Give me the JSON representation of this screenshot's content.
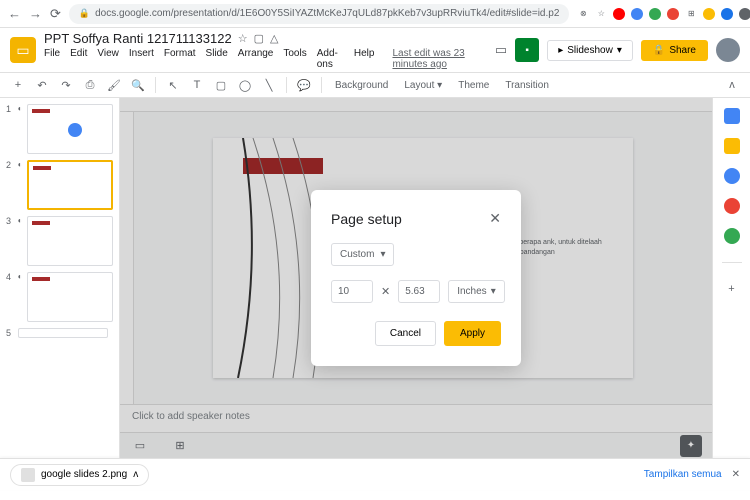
{
  "browser": {
    "url": "docs.google.com/presentation/d/1E6O0Y5SiIYAZtMcKeJ7qULd87pkKeb7v3upRRviuTk4/edit#slide=id.p2"
  },
  "header": {
    "doc_title": "PPT Soffya Ranti 121711133122",
    "menus": [
      "File",
      "Edit",
      "View",
      "Insert",
      "Format",
      "Slide",
      "Arrange",
      "Tools",
      "Add-ons",
      "Help"
    ],
    "last_edit": "Last edit was 23 minutes ago",
    "slideshow_label": "Slideshow",
    "share_label": "Share"
  },
  "toolbar": {
    "background": "Background",
    "layout": "Layout",
    "theme": "Theme",
    "transition": "Transition"
  },
  "thumbs": [
    {
      "num": "1"
    },
    {
      "num": "2"
    },
    {
      "num": "3"
    },
    {
      "num": "4"
    },
    {
      "num": "5"
    }
  ],
  "slide": {
    "body_text": "terbagi oleh beberapa ank, untuk ditelaah yang terhadap pandangan"
  },
  "speaker_notes": {
    "placeholder": "Click to add speaker notes"
  },
  "modal": {
    "title": "Page setup",
    "size_type": "Custom",
    "width": "10",
    "height": "5.63",
    "unit": "Inches",
    "cancel": "Cancel",
    "apply": "Apply"
  },
  "download": {
    "filename": "google slides 2.png",
    "show_all": "Tampilkan semua"
  }
}
